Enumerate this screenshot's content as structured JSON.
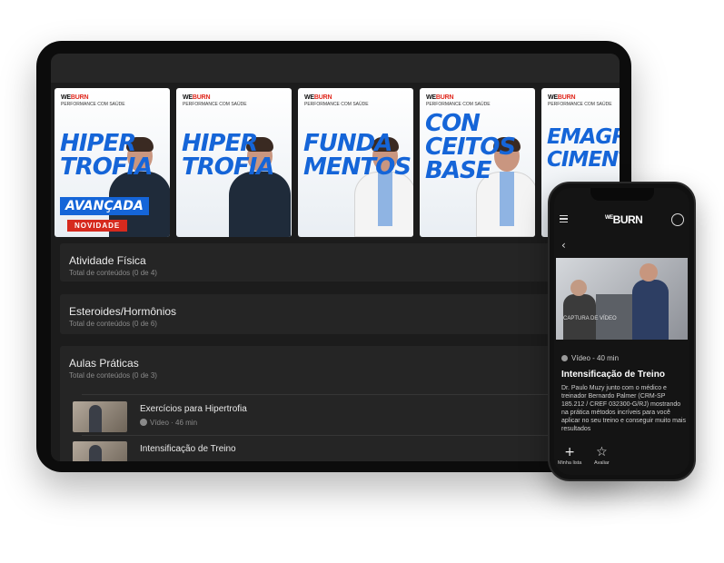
{
  "brand": {
    "logo_prefix": "WE",
    "logo_name": "BURN",
    "tagline": "PERFORMANCE COM SAÚDE"
  },
  "tablet": {
    "posters": [
      {
        "title_line1": "HIPER",
        "title_line2": "TROFIA",
        "badge": "AVANÇADA",
        "ribbon": "NOVIDADE"
      },
      {
        "title_line1": "HIPER",
        "title_line2": "TROFIA",
        "badge": "",
        "ribbon": ""
      },
      {
        "title_line1": "FUNDA",
        "title_line2": "MENTOS",
        "badge": "",
        "ribbon": ""
      },
      {
        "title_line1": "CON",
        "title_line2": "CEITOS",
        "title_line3": "BASE",
        "badge": "",
        "ribbon": ""
      },
      {
        "title_line1": "EMAGRE",
        "title_line2": "CIMENTO",
        "badge": "",
        "ribbon": ""
      }
    ],
    "sections": [
      {
        "title": "Atividade Física",
        "subtitle": "Total de conteúdos (0 de 4)"
      },
      {
        "title": "Esteroides/Hormônios",
        "subtitle": "Total de conteúdos (0 de 6)"
      },
      {
        "title": "Aulas Práticas",
        "subtitle": "Total de conteúdos (0 de 3)"
      }
    ],
    "lessons": [
      {
        "title": "Exercícios para Hipertrofia",
        "meta": "Vídeo · 46 min"
      },
      {
        "title": "Intensificação de Treino",
        "meta": ""
      }
    ]
  },
  "phone": {
    "video_watermark": "CAPTURA DE VÍDEO",
    "meta": "Vídeo - 40 min",
    "title": "Intensificação de Treino",
    "description": "Dr. Paulo Muzy junto com o médico e treinador Bernardo Palmer (CRM-SP 185.212 / CREF 032300-G/RJ) mostrando na prática métodos incríveis para você aplicar no seu treino e conseguir muito mais resultados",
    "actions": [
      {
        "icon": "plus-icon",
        "glyph": "+",
        "label": "Minha lista"
      },
      {
        "icon": "star-icon",
        "glyph": "☆",
        "label": "Avaliar"
      }
    ]
  }
}
